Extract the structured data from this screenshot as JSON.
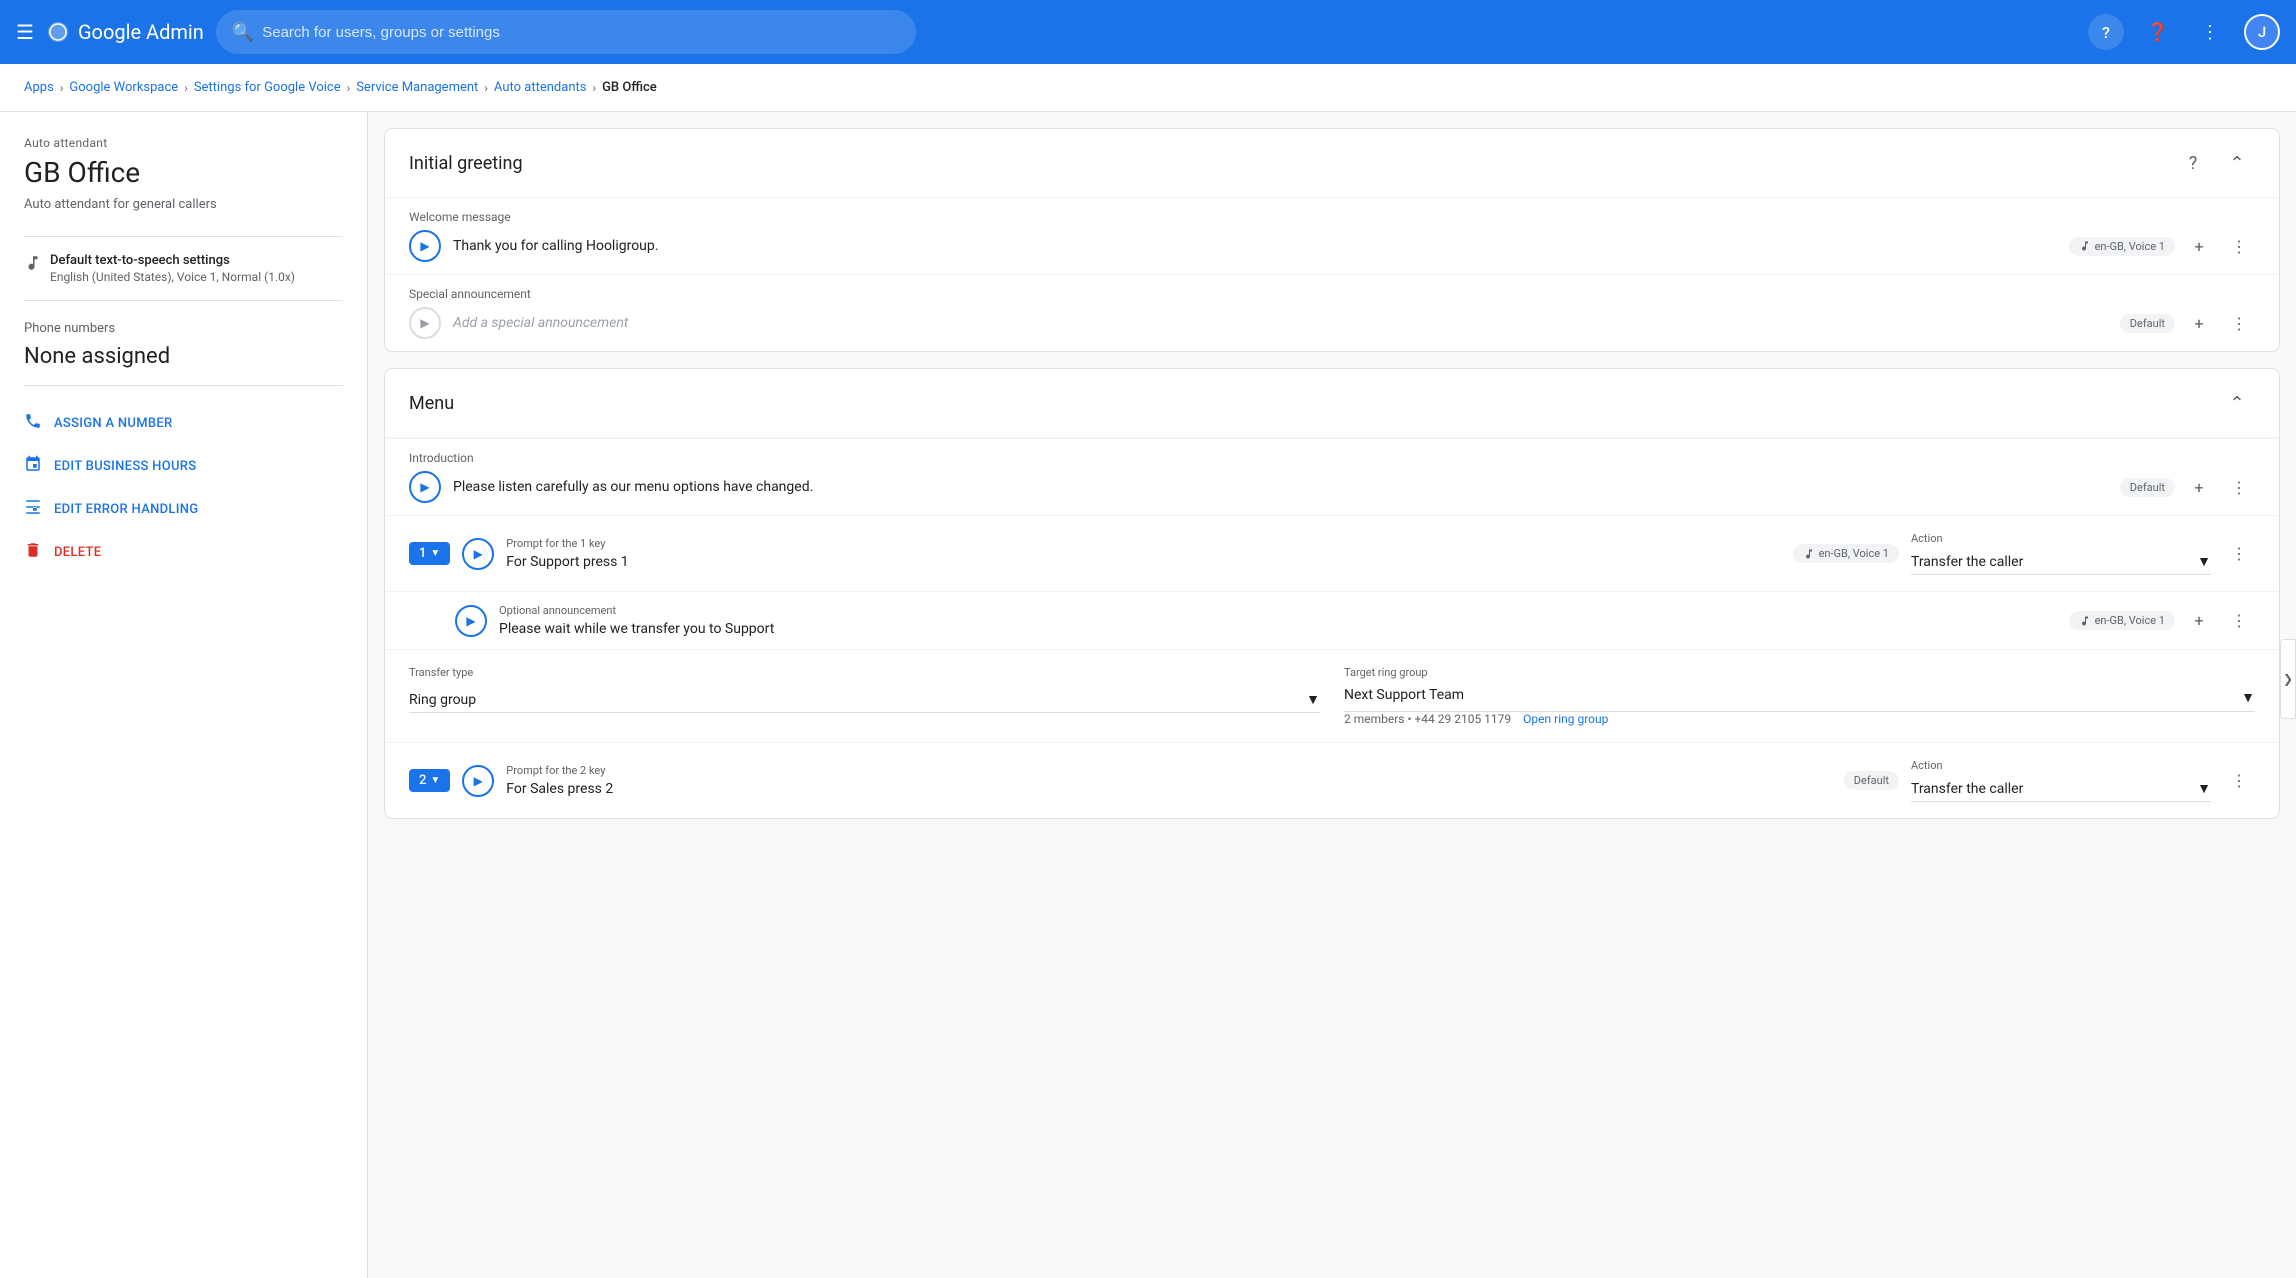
{
  "topbar": {
    "menu_label": "Menu",
    "logo_text": "Google Admin",
    "search_placeholder": "Search for users, groups or settings",
    "avatar_initial": "J",
    "help_icon": "?",
    "apps_icon": "⋮⋮⋮"
  },
  "breadcrumb": {
    "items": [
      "Apps",
      "Google Workspace",
      "Settings for Google Voice",
      "Service Management",
      "Auto attendants",
      "GB Office"
    ]
  },
  "sidebar": {
    "auto_attendant_label": "Auto attendant",
    "title": "GB Office",
    "subtitle": "Auto attendant for general callers",
    "tts_icon": "tts-icon",
    "tts_label": "Default text-to-speech settings",
    "tts_value": "English (United States), Voice 1, Normal (1.0x)",
    "phone_numbers_label": "Phone numbers",
    "phone_numbers_value": "None assigned",
    "actions": [
      {
        "icon": "phone-icon",
        "label": "ASSIGN A NUMBER"
      },
      {
        "icon": "calendar-icon",
        "label": "EDIT BUSINESS HOURS"
      },
      {
        "icon": "edit-routing-icon",
        "label": "EDIT ERROR HANDLING"
      },
      {
        "icon": "delete-icon",
        "label": "DELETE",
        "type": "delete"
      }
    ]
  },
  "initial_greeting": {
    "title": "Initial greeting",
    "welcome_message_label": "Welcome message",
    "welcome_message_text": "Thank you for calling Hooligroup.",
    "welcome_voice_badge": "en-GB, Voice 1",
    "special_announcement_label": "Special announcement",
    "special_announcement_placeholder": "Add a special announcement",
    "special_announcement_badge": "Default"
  },
  "menu": {
    "title": "Menu",
    "introduction_label": "Introduction",
    "introduction_text": "Please listen carefully as our menu options have changed.",
    "introduction_badge": "Default",
    "key1": {
      "badge": "1",
      "prompt_label": "Prompt for the 1 key",
      "prompt_text": "For Support press 1",
      "voice_badge": "en-GB, Voice 1",
      "action_label": "Action",
      "action_value": "Transfer the caller",
      "optional_label": "Optional announcement",
      "optional_text": "Please wait while we transfer you to Support",
      "optional_voice": "en-GB, Voice 1",
      "transfer_type_label": "Transfer type",
      "transfer_type_value": "Ring group",
      "target_ring_group_label": "Target ring group",
      "target_ring_group_value": "Next Support Team",
      "ring_group_meta": "2 members • +44 29 2105 1179",
      "open_ring_group": "Open ring group"
    },
    "key2": {
      "badge": "2",
      "prompt_label": "Prompt for the 2 key",
      "prompt_text": "For Sales press 2",
      "voice_badge": "Default",
      "action_label": "Action",
      "action_value": "Transfer the caller"
    }
  }
}
